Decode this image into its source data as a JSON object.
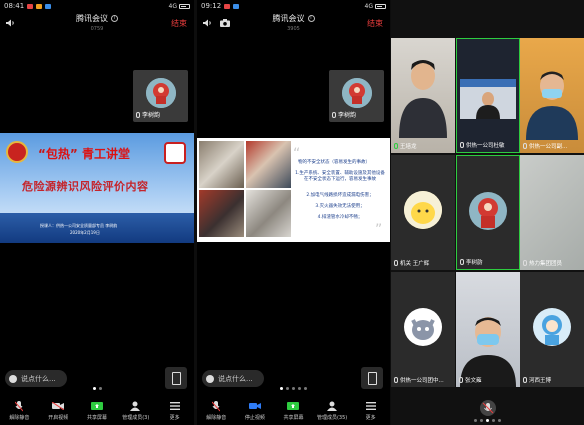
{
  "panel1": {
    "status_time": "08:41",
    "app_title": "腾讯会议",
    "meeting_id": "0759",
    "end_label": "结束",
    "self_name": "李树韵",
    "slide": {
      "title_quote_open": "“",
      "title_main": "包热",
      "title_quote_close": "”",
      "title_rest": "青工讲堂",
      "subtitle": "危险源辨识风险评价内容",
      "presenter": "授课人：供热一公司安全质量部专员  李树韵",
      "date": "2020年2月19日"
    },
    "comment_placeholder": "说点什么..."
  },
  "panel2": {
    "status_time": "09:12",
    "app_title": "腾讯会议",
    "meeting_id": "3905",
    "end_label": "结束",
    "self_name": "李树韵",
    "slide": {
      "heading": "物的不安全状态（容易发生的事故）",
      "items": [
        "1.生产系统、安全装置、辅助设施及其他设备在不安全状态下运行，容易发生事故",
        "2.加电气线路损坏造成漏电伤害；",
        "3.灭火器失效无法使用；",
        "4.排渣管水冷却不畅；"
      ]
    },
    "comment_placeholder": "说点什么..."
  },
  "toolbar_p1": [
    {
      "label": "解除静音"
    },
    {
      "label": "开启视频"
    },
    {
      "label": "共享屏幕"
    },
    {
      "label": "管理成员(3)"
    },
    {
      "label": "更多"
    }
  ],
  "toolbar_p2": [
    {
      "label": "解除静音"
    },
    {
      "label": "停止视频"
    },
    {
      "label": "共享屏幕"
    },
    {
      "label": "管理成员(35)"
    },
    {
      "label": "更多"
    }
  ],
  "panel3": {
    "participants": [
      {
        "name": "王培龙"
      },
      {
        "name": "供热一公司杜敏"
      },
      {
        "name": "供热一公司副..."
      },
      {
        "name": "机关 王广辉"
      },
      {
        "name": "李树韵"
      },
      {
        "name": "热力集团团员"
      },
      {
        "name": "供热一公司团中..."
      },
      {
        "name": "张文雍"
      },
      {
        "name": "河西王博"
      }
    ]
  },
  "colors": {
    "end_red": "#ea3d3d",
    "slide_title_red": "#d11111",
    "slide_text_blue": "#1c3f8c",
    "active_green": "#2ecc40",
    "video_blue": "#2f7cf6"
  },
  "icons": [
    "speaker-icon",
    "camera-switch-icon",
    "info-icon",
    "mic-icon",
    "camera-icon",
    "share-screen-icon",
    "members-icon",
    "more-icon",
    "rotate-icon",
    "emoji-icon"
  ]
}
